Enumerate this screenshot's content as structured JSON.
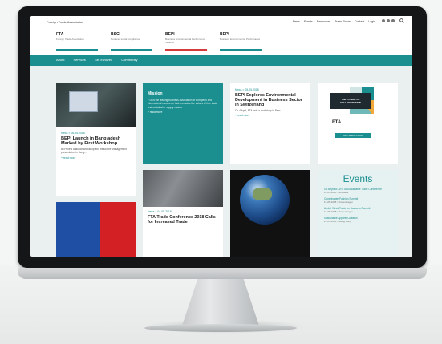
{
  "site": {
    "brand": "Foreign Trade Association",
    "top_nav": [
      "News",
      "Events",
      "Resources",
      "Press Room",
      "Contact",
      "Login"
    ],
    "tabs": [
      {
        "title": "FTA",
        "sub": "Foreign Trade Association",
        "color": "#1b8f90"
      },
      {
        "title": "BSCI",
        "sub": "business social compliance",
        "color": "#1b8f90"
      },
      {
        "title": "BEPI",
        "sub": "Business Environmental Performance Initiative",
        "color": "#d33a3a"
      },
      {
        "title": "BEPI",
        "sub": "Business Environmental Performance",
        "color": "#1b8f90"
      }
    ],
    "main_nav": [
      "About",
      "Services",
      "Get Involved",
      "Community"
    ]
  },
  "cards": {
    "news1": {
      "date": "News > 06-05-2018",
      "title": "BEPI Launch in Bangladesh Marked by First Workshop",
      "body": "BEPI held a launch workshop and Resource Management presentation in Bang...",
      "more": "+ read more"
    },
    "mission": {
      "title": "Mission",
      "body": "FTA is the leading business association of European and international commerce that promotes the values of free trade and sustainable supply chains.",
      "more": "+ read more"
    },
    "news2": {
      "date": "News > 05-05-2018",
      "title": "BEPI Explores Environmental Development in Business Sector in Switzerland",
      "body": "On 4 April, FTA held a workshop in Bern.",
      "more": "+ read more"
    },
    "promo": {
      "text": "THE POWER OF COLLABORATION",
      "brand": "FTA",
      "button": "REGISTER NOW"
    },
    "news3": {
      "date": "News > 04-05-2018",
      "title": "FTA Trade Conference 2018 Calls for Increased Trade",
      "body": "",
      "more": ""
    },
    "events": {
      "title": "Events",
      "items": [
        {
          "label": "Go Beyond: An FTA Sustainable Trade Conference",
          "meta": "22-05-2018 > Brussels"
        },
        {
          "label": "Copenhagen Fashion Summit",
          "meta": "15-05-2018 > Copenhagen"
        },
        {
          "label": "Amfori Week Trade for Business Summit",
          "meta": "16-05-2018 > Copenhagen"
        },
        {
          "label": "Sustainable Apparel Coalition",
          "meta": "22-05-2018 > Hong Kong"
        }
      ]
    }
  }
}
